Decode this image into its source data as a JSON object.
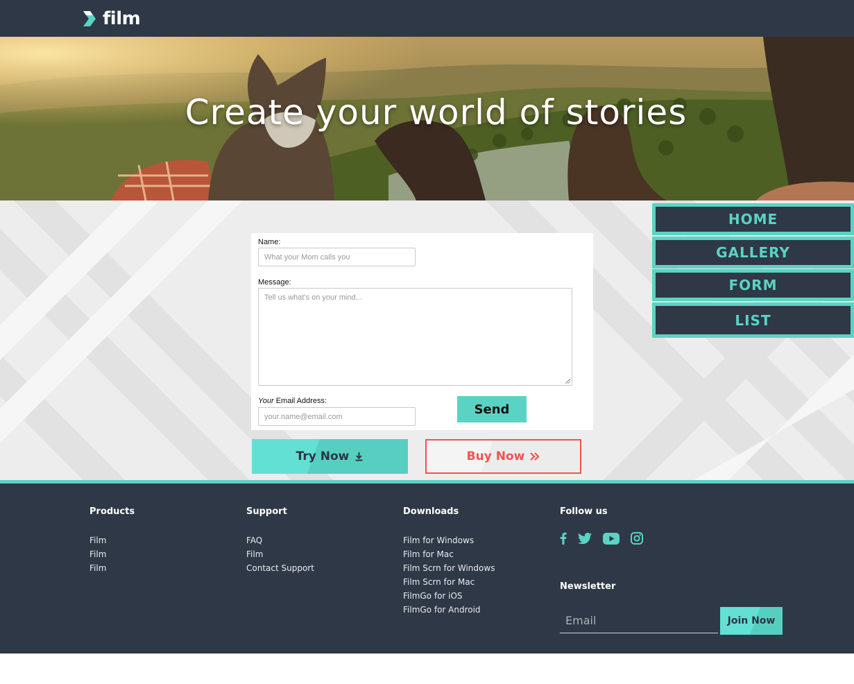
{
  "brand": {
    "name": "film"
  },
  "hero": {
    "title": "Create your world of stories"
  },
  "form": {
    "name_label": "Name:",
    "name_placeholder": "What your Mom calls you",
    "message_label": "Message:",
    "message_placeholder": "Tell us what's on your mind...",
    "email_label_em": "Your",
    "email_label_rest": " Email Address:",
    "email_placeholder": "your.name@email.com",
    "send_label": "Send"
  },
  "cta": {
    "try_label": "Try Now",
    "buy_label": "Buy Now"
  },
  "sidenav": {
    "items": [
      {
        "label": "HOME"
      },
      {
        "label": "GALLERY"
      },
      {
        "label": "FORM"
      },
      {
        "label": "LIST"
      }
    ]
  },
  "footer": {
    "products": {
      "heading": "Products",
      "links": [
        "Film",
        "Film",
        "Film"
      ]
    },
    "support": {
      "heading": "Support",
      "links": [
        "FAQ",
        "Film",
        "Contact Support"
      ]
    },
    "downloads": {
      "heading": "Downloads",
      "links": [
        "Film for Windows",
        "Film for Mac",
        "Film Scrn for Windows",
        "Film Scrn for Mac",
        "FilmGo for iOS",
        "FilmGo for Android"
      ]
    },
    "follow": {
      "heading": "Follow us",
      "icons": [
        "facebook-icon",
        "twitter-icon",
        "youtube-icon",
        "instagram-icon"
      ]
    },
    "newsletter": {
      "heading": "Newsletter",
      "email_placeholder": "Email",
      "join_label": "Join Now"
    }
  },
  "colors": {
    "dark": "#2e3846",
    "accent": "#5bd3c4",
    "danger": "#ef5350"
  }
}
